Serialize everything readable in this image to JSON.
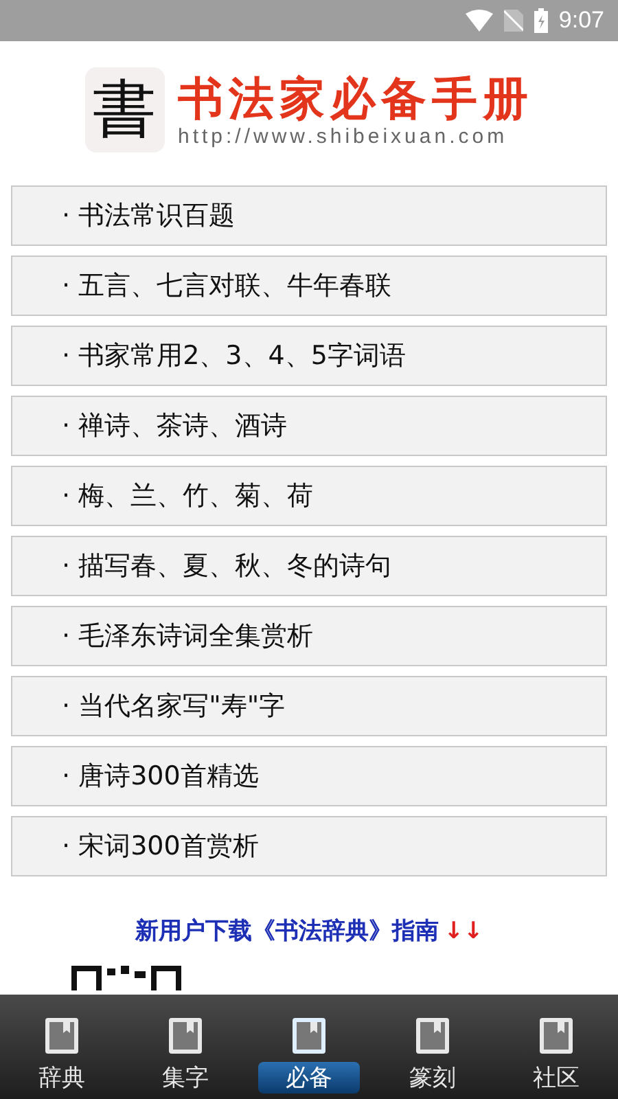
{
  "status_bar": {
    "time": "9:07"
  },
  "header": {
    "logo_char": "書",
    "title": "书法家必备手册",
    "url": "http://www.shibeixuan.com"
  },
  "menu": [
    {
      "label": "· 书法常识百题"
    },
    {
      "label": "· 五言、七言对联、牛年春联"
    },
    {
      "label": "· 书家常用2、3、4、5字词语"
    },
    {
      "label": "· 禅诗、茶诗、酒诗"
    },
    {
      "label": "· 梅、兰、竹、菊、荷"
    },
    {
      "label": "· 描写春、夏、秋、冬的诗句"
    },
    {
      "label": "· 毛泽东诗词全集赏析"
    },
    {
      "label": "· 当代名家写\"寿\"字"
    },
    {
      "label": "· 唐诗300首精选"
    },
    {
      "label": "· 宋词300首赏析"
    }
  ],
  "guide": {
    "text": "新用户下载《书法辞典》指南",
    "arrows": "↓↓"
  },
  "tabs": [
    {
      "label": "辞典",
      "selected": false
    },
    {
      "label": "集字",
      "selected": false
    },
    {
      "label": "必备",
      "selected": true
    },
    {
      "label": "篆刻",
      "selected": false
    },
    {
      "label": "社区",
      "selected": false
    }
  ]
}
